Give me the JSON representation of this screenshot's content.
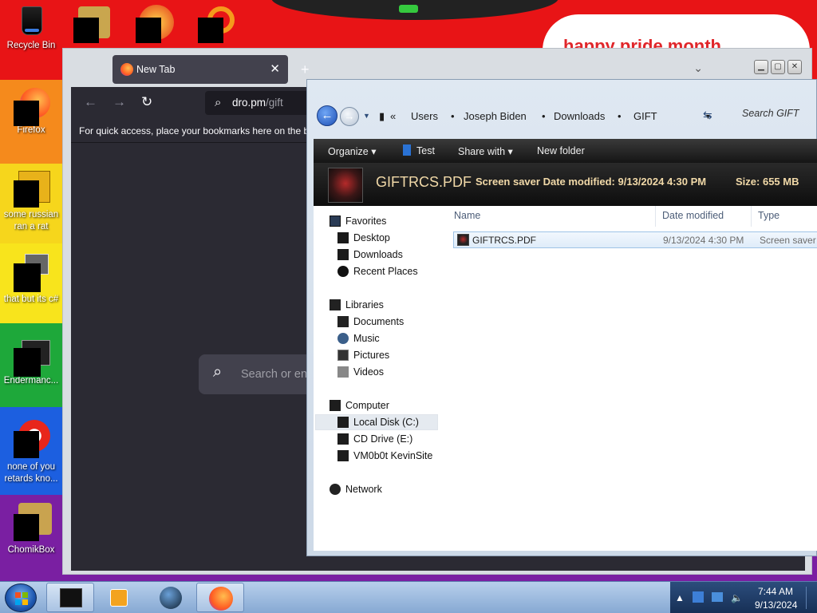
{
  "desktop": {
    "banner_text": "happy pride month",
    "icons": [
      {
        "label": "Recycle Bin"
      },
      {
        "label": "Firefox"
      },
      {
        "label": "some russian ran a rat"
      },
      {
        "label": "that but its c#"
      },
      {
        "label": "Endermanc..."
      },
      {
        "label": "none of you retards kno..."
      },
      {
        "label": "ChomikBox"
      }
    ]
  },
  "firefox": {
    "tab_title": "New Tab",
    "tab_close": "✕",
    "new_tab": "+",
    "chevron": "⌄",
    "url_host": "dro.pm",
    "url_path": "/gift",
    "bookmarks_hint": "For quick access, place your bookmarks here on the bookmarks toolbar.",
    "search_placeholder": "Search or enter address",
    "back": "←",
    "forward": "→",
    "reload": "↻",
    "search_glyph": "🔍"
  },
  "explorer": {
    "breadcrumb": [
      "Users",
      "Joseph Biden",
      "Downloads",
      "GIFT"
    ],
    "breadcrumb_prefix": "«",
    "search_placeholder": "Search GIFT",
    "toolbar": {
      "organize": "Organize ▾",
      "test": "Test",
      "share_with": "Share with ▾",
      "new_folder": "New folder"
    },
    "details": {
      "file_name": "GIFTRCS.PDF",
      "file_type": "Screen saver",
      "date_label": "Date modified:",
      "date_value": "9/13/2024 4:30 PM",
      "size_label": "Size:",
      "size_value": "655 MB"
    },
    "nav": {
      "favorites": "Favorites",
      "desktop": "Desktop",
      "downloads": "Downloads",
      "recent_places": "Recent Places",
      "libraries": "Libraries",
      "documents": "Documents",
      "music": "Music",
      "pictures": "Pictures",
      "videos": "Videos",
      "computer": "Computer",
      "local_disk": "Local Disk (C:)",
      "cd_drive": "CD Drive (E:)",
      "vm_site": "VM0b0t KevinSite",
      "network": "Network"
    },
    "columns": {
      "name": "Name",
      "date_modified": "Date modified",
      "type": "Type"
    },
    "files": [
      {
        "name": "GIFTRCS.PDF",
        "date_modified": "9/13/2024 4:30 PM",
        "type": "Screen saver"
      }
    ]
  },
  "taskbar": {
    "time": "7:44 AM",
    "date": "9/13/2024"
  }
}
